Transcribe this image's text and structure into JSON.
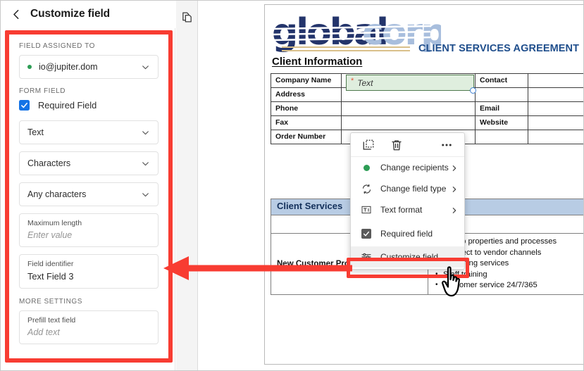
{
  "panel": {
    "title": "Customize field",
    "back_icon": "chevron-left-icon",
    "sections": {
      "assigned_label": "FIELD ASSIGNED TO",
      "assigned_value": "io@jupiter.dom",
      "form_field_label": "FORM FIELD",
      "required_checkbox_label": "Required Field",
      "required_checked": true,
      "field_type_value": "Text",
      "count_unit_value": "Characters",
      "char_rule_value": "Any characters",
      "max_length_label": "Maximum length",
      "max_length_placeholder": "Enter value",
      "field_identifier_label": "Field identifier",
      "field_identifier_value": "Text Field 3",
      "more_settings_label": "MORE SETTINGS",
      "prefill_label": "Prefill text field",
      "prefill_placeholder": "Add text"
    }
  },
  "mini_toolbar": {
    "pages_icon": "pages-icon"
  },
  "context_menu": {
    "tools": [
      {
        "name": "duplicate-icon",
        "label": "Duplicate"
      },
      {
        "name": "delete-icon",
        "label": "Delete"
      },
      {
        "name": "more-options-icon",
        "label": "More options"
      }
    ],
    "items": [
      {
        "label": "Change recipients",
        "icon": "recipient-dot-icon",
        "submenu": true
      },
      {
        "label": "Change field type",
        "icon": "refresh-icon",
        "submenu": true
      },
      {
        "label": "Text format",
        "icon": "text-format-icon",
        "submenu": true
      },
      {
        "label": "Required field",
        "icon": "checkbox-checked-icon",
        "submenu": false
      },
      {
        "label": "Customize field",
        "icon": "sliders-icon",
        "submenu": false,
        "highlighted": true
      }
    ]
  },
  "document": {
    "logo": {
      "part1": "global",
      "part2": "corp"
    },
    "agreement_title": "CLIENT SERVICES AGREEMENT",
    "client_info_heading": "Client Information",
    "selected_field": {
      "required_marker": "*",
      "placeholder": "Text"
    },
    "client_table": {
      "left_rows": [
        "Company Name",
        "Address",
        "Phone",
        "Fax",
        "Order Number"
      ],
      "right_rows": [
        "Contact",
        "",
        "Email",
        "Website",
        ""
      ]
    },
    "services": {
      "band_title": "Client Services",
      "row_label": "New Customer Program",
      "bullets": [
        "Set up properties and processes",
        "Connect to vendor channels",
        "Marketing services",
        "Staff training",
        "Customer service 24/7/365"
      ]
    }
  },
  "annotations": {
    "highlight_color": "#f83c32",
    "arrow_name": "red-callout-arrow"
  },
  "colors": {
    "accent_blue": "#1473e6",
    "logo_navy": "#23346b",
    "logo_lightblue": "#a8bedd",
    "band_blue": "#b8cce4",
    "green_field": "#dfeede",
    "green_dot": "#2d9d55"
  }
}
